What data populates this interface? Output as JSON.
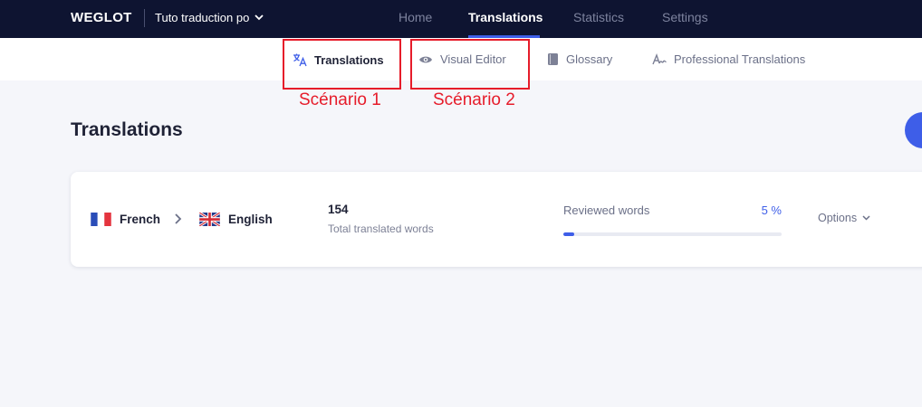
{
  "header": {
    "logo": "WEGLOT",
    "project": "Tuto traduction po",
    "nav": [
      {
        "label": "Home",
        "active": false
      },
      {
        "label": "Translations",
        "active": true
      },
      {
        "label": "Statistics",
        "active": false
      },
      {
        "label": "Settings",
        "active": false
      }
    ]
  },
  "subnav": {
    "items": [
      {
        "label": "Translations",
        "icon": "translate-icon",
        "active": true
      },
      {
        "label": "Visual Editor",
        "icon": "eye-icon",
        "active": false
      },
      {
        "label": "Glossary",
        "icon": "book-icon",
        "active": false
      },
      {
        "label": "Professional Translations",
        "icon": "signature-icon",
        "active": false
      }
    ]
  },
  "annotations": {
    "scenario1": "Scénario 1",
    "scenario2": "Scénario 2",
    "color": "#e61c2a"
  },
  "page": {
    "title": "Translations"
  },
  "card": {
    "source_language": "French",
    "source_flag": "france-flag-icon",
    "target_language": "English",
    "target_flag": "uk-flag-icon",
    "translated_count": "154",
    "translated_label": "Total translated words",
    "reviewed_label": "Reviewed words",
    "reviewed_percent_text": "5 %",
    "reviewed_fraction": 0.05,
    "options_label": "Options"
  },
  "colors": {
    "topbar": "#0e1431",
    "accent": "#3e5ee8",
    "background": "#f5f6fa"
  }
}
